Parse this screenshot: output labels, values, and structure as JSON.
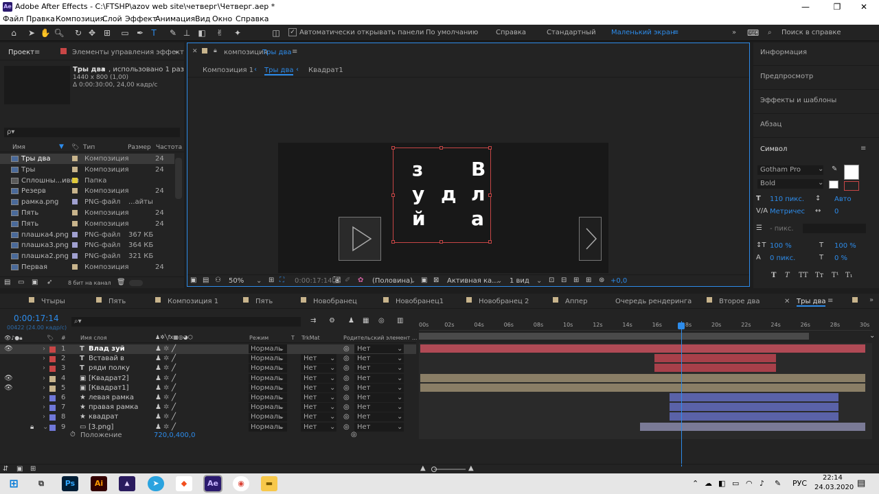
{
  "window": {
    "app_icon": "Ae",
    "title": "Adobe After Effects - C:\\FTSHP\\azov web site\\четверг\\Четверг.aep *"
  },
  "menu": [
    "Файл",
    "Правка",
    "Композиция",
    "Слой",
    "Эффект",
    "Анимация",
    "Вид",
    "Окно",
    "Справка"
  ],
  "toolbar": {
    "auto_open_panels": "Автоматически открывать панели",
    "workspaces": [
      "По умолчанию",
      "Справка",
      "Стандартный",
      "Маленький экран"
    ],
    "search_placeholder": "Поиск в справке"
  },
  "project_panel": {
    "tab_project": "Проект",
    "tab_effects": "Элементы управления эффект",
    "selected_name": "Тры два",
    "selected_usage": ", использовано 1 раз",
    "selected_size": "1440 x 800 (1,00)",
    "selected_duration": "Δ 0:00:30:00, 24,00 кадр/с",
    "search_placeholder": "ρ▾",
    "columns": [
      "Имя",
      "Тип",
      "Размер",
      "Частота ..."
    ],
    "items": [
      {
        "name": "Тры два",
        "type": "Композиция",
        "size": "",
        "rate": "24",
        "color": "#c8b48c",
        "selected": true
      },
      {
        "name": "Тры",
        "type": "Композиция",
        "size": "",
        "rate": "24",
        "color": "#c8b48c"
      },
      {
        "name": "Сплошны...ивки",
        "type": "Папка",
        "size": "",
        "rate": "",
        "color": "#e0c93a"
      },
      {
        "name": "Резерв",
        "type": "Композиция",
        "size": "",
        "rate": "24",
        "color": "#c8b48c"
      },
      {
        "name": "рамка.png",
        "type": "PNG-файл",
        "size": "...айты",
        "rate": "",
        "color": "#a0a0d0"
      },
      {
        "name": "Пять",
        "type": "Композиция",
        "size": "",
        "rate": "24",
        "color": "#c8b48c"
      },
      {
        "name": "Пять",
        "type": "Композиция",
        "size": "",
        "rate": "24",
        "color": "#c8b48c"
      },
      {
        "name": "плашка4.png",
        "type": "PNG-файл",
        "size": "367 КБ",
        "rate": "",
        "color": "#a0a0d0"
      },
      {
        "name": "плашка3.png",
        "type": "PNG-файл",
        "size": "364 КБ",
        "rate": "",
        "color": "#a0a0d0"
      },
      {
        "name": "плашка2.png",
        "type": "PNG-файл",
        "size": "321 КБ",
        "rate": "",
        "color": "#a0a0d0"
      },
      {
        "name": "Первая",
        "type": "Композиция",
        "size": "",
        "rate": "24",
        "color": "#c8b48c"
      }
    ],
    "bit_depth": "8 бит на канал"
  },
  "comp_panel": {
    "tab_label": "композиция",
    "tab_name": "Тры два",
    "breadcrumbs": [
      "Композиция 1",
      "Тры два",
      "Квадрат1"
    ],
    "glyphs": [
      "з",
      "у",
      "й",
      "д",
      "В",
      "л",
      "а"
    ],
    "zoom": "50%",
    "timecode": "0:00:17:14",
    "resolution": "(Половина)",
    "camera": "Активная ка...",
    "views": "1 вид",
    "exposure": "+0,0"
  },
  "right_panel": {
    "items": [
      "Информация",
      "Предпросмотр",
      "Эффекты и шаблоны",
      "Абзац",
      "Символ"
    ],
    "font": "Gotham Pro",
    "style": "Bold",
    "size": "110 пикс.",
    "leading": "Авто",
    "kerning": "Метричес",
    "tracking": "0",
    "stroke": "- пикс.",
    "vscale": "100 %",
    "hscale": "100 %",
    "baseline": "0 пикс.",
    "tsume": "0 %",
    "styles": [
      "T",
      "T",
      "TT",
      "Tт",
      "T¹",
      "T₁"
    ]
  },
  "timeline": {
    "tabs": [
      {
        "label": "Чтыры",
        "color": "#c8b48c"
      },
      {
        "label": "Пять",
        "color": "#c8b48c"
      },
      {
        "label": "Композиция 1",
        "color": "#c8b48c"
      },
      {
        "label": "Пять",
        "color": "#c8b48c"
      },
      {
        "label": "Новобранец",
        "color": "#c8b48c"
      },
      {
        "label": "Новобранец1",
        "color": "#c8b48c"
      },
      {
        "label": "Новобранец 2",
        "color": "#c8b48c"
      },
      {
        "label": "Аппер",
        "color": "#c8b48c"
      },
      {
        "label": "Очередь рендеринга",
        "color": ""
      },
      {
        "label": "Второе два",
        "color": "#c8b48c"
      },
      {
        "label": "Тры два",
        "color": ""
      }
    ],
    "timecode": "0:00:17:14",
    "frames": "00422 (24.00 кадр/с)",
    "columns": {
      "name": "Имя слоя",
      "mode": "Режим",
      "t": "T",
      "trkmat": "TrkMat",
      "parent": "Родительский элемент ..."
    },
    "ruler": [
      "00s",
      "02s",
      "04s",
      "06s",
      "08s",
      "10s",
      "12s",
      "14s",
      "16s",
      "18s",
      "20s",
      "22s",
      "24s",
      "26s",
      "28s",
      "30s"
    ],
    "playhead_seconds": 17.58,
    "work_area_end_seconds": 26.2,
    "layers": [
      {
        "num": "1",
        "type": "T",
        "name": "Влад зуй",
        "mode": "Нормаль",
        "trk": "",
        "parent": "Нет",
        "label": "#c84646",
        "bar_color": "#b04a55",
        "start": 0,
        "end": 30,
        "eye": true,
        "selected": true
      },
      {
        "num": "2",
        "type": "T",
        "name": "Вставай в",
        "mode": "Нормаль",
        "trk": "Нет",
        "parent": "Нет",
        "label": "#c84646",
        "bar_color": "#a8404a",
        "start": 15.8,
        "end": 24.0,
        "eye": false
      },
      {
        "num": "3",
        "type": "T",
        "name": "ряди полку",
        "mode": "Нормаль",
        "trk": "Нет",
        "parent": "Нет",
        "label": "#c84646",
        "bar_color": "#a8404a",
        "start": 15.8,
        "end": 24.0,
        "eye": false
      },
      {
        "num": "4",
        "type": "▣",
        "name": "[Квадрат2]",
        "mode": "Нормаль",
        "trk": "Нет",
        "parent": "Нет",
        "label": "#c8b48c",
        "bar_color": "#8a7e66",
        "start": 0,
        "end": 30,
        "eye": true
      },
      {
        "num": "5",
        "type": "▣",
        "name": "[Квадрат1]",
        "mode": "Нормаль",
        "trk": "Нет",
        "parent": "Нет",
        "label": "#c8b48c",
        "bar_color": "#8a7e66",
        "start": 0,
        "end": 30,
        "eye": true
      },
      {
        "num": "6",
        "type": "★",
        "name": "левая рамка",
        "mode": "Нормаль",
        "trk": "Нет",
        "parent": "Нет",
        "label": "#7078d8",
        "bar_color": "#5a62a8",
        "start": 16.8,
        "end": 28.2,
        "eye": false
      },
      {
        "num": "7",
        "type": "★",
        "name": "правая рамка",
        "mode": "Нормаль",
        "trk": "Нет",
        "parent": "Нет",
        "label": "#7078d8",
        "bar_color": "#5a62a8",
        "start": 16.8,
        "end": 28.2,
        "eye": false
      },
      {
        "num": "8",
        "type": "★",
        "name": "квадрат",
        "mode": "Нормаль",
        "trk": "Нет",
        "parent": "Нет",
        "label": "#7078d8",
        "bar_color": "#5a62a8",
        "start": 16.8,
        "end": 28.2,
        "eye": false
      },
      {
        "num": "9",
        "type": "▭",
        "name": "[3.png]",
        "mode": "Нормаль",
        "trk": "Нет",
        "parent": "Нет",
        "label": "#7078d8",
        "bar_color": "#7a7a96",
        "start": 14.8,
        "end": 30,
        "eye": false
      }
    ],
    "property_name": "Положение",
    "property_value": "720,0,400,0"
  },
  "taskbar": {
    "apps": [
      "Ps",
      "Ai",
      "Pr",
      "Tg",
      "Fg",
      "Ae",
      "Chrome",
      "Folder"
    ],
    "lang": "РУС",
    "time": "22:14",
    "date": "24.03.2020"
  }
}
